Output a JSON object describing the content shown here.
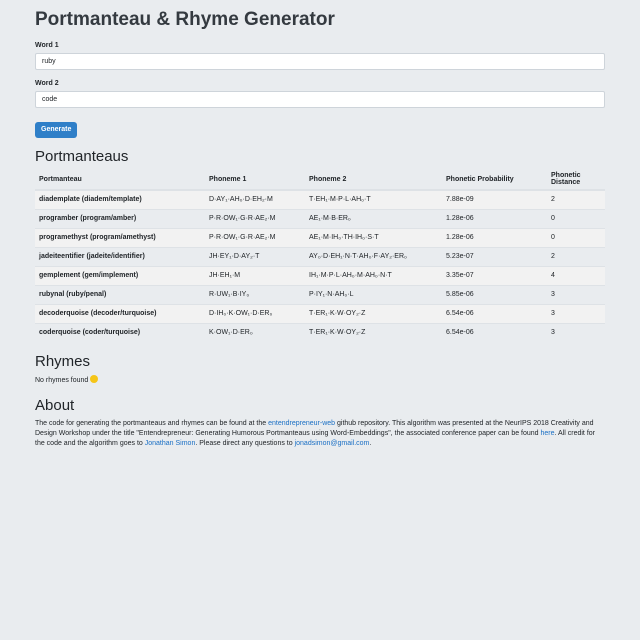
{
  "title": "Portmanteau & Rhyme Generator",
  "word1": {
    "label": "Word 1",
    "value": "ruby"
  },
  "word2": {
    "label": "Word 2",
    "value": "code"
  },
  "generate_label": "Generate",
  "portmanteaus": {
    "heading": "Portmanteaus",
    "columns": [
      "Portmanteau",
      "Phoneme 1",
      "Phoneme 2",
      "Phonetic Probability",
      "Phonetic Distance"
    ],
    "rows": [
      {
        "word": "diadem​plate (diadem/template)",
        "p1": "D·AY₁·AH₀·D·EH₂·M",
        "p2": "T·EH₁·M·P·L·AH₀·T",
        "prob": "7.88e-09",
        "dist": "2"
      },
      {
        "word": "programber (program/amber)",
        "p1": "P·R·OW₁·G·R·AE₂·M",
        "p2": "AE₁·M·B·ER₀",
        "prob": "1.28e-06",
        "dist": "0"
      },
      {
        "word": "programethyst (program/amethyst)",
        "p1": "P·R·OW₁·G·R·AE₂·M",
        "p2": "AE₁·M·IH₀·TH·IH₀·S·T",
        "prob": "1.28e-06",
        "dist": "0"
      },
      {
        "word": "jadeiteentifier (jadeite/identifier)",
        "p1": "JH·EY₁·D·AY₂·T",
        "p2": "AY₀·D·EH₁·N·T·AH₀·F·AY₂·ER₀",
        "prob": "5.23e-07",
        "dist": "2"
      },
      {
        "word": "gemplement (gem/implement)",
        "p1": "JH·EH₁·M",
        "p2": "IH₁·M·P·L·AH₀·M·AH₀·N·T",
        "prob": "3.35e-07",
        "dist": "4"
      },
      {
        "word": "rubynal (ruby/penal)",
        "p1": "R·UW₁·B·IY₀",
        "p2": "P·IY₁·N·AH₀·L",
        "prob": "5.85e-06",
        "dist": "3"
      },
      {
        "word": "decoderquoise (decoder/turquoise)",
        "p1": "D·IH₀·K·OW₁·D·ER₀",
        "p2": "T·ER₁·K·W·OY₂·Z",
        "prob": "6.54e-06",
        "dist": "3"
      },
      {
        "word": "coderquoise (coder/turquoise)",
        "p1": "K·OW₁·D·ER₀",
        "p2": "T·ER₁·K·W·OY₂·Z",
        "prob": "6.54e-06",
        "dist": "3"
      }
    ]
  },
  "rhymes": {
    "heading": "Rhymes",
    "empty_text": "No rhymes found",
    "emoji_icon": "smiley-face-icon"
  },
  "about": {
    "heading": "About",
    "t1": "The code for generating the portmanteaus and rhymes can be found at the ",
    "link1": "entendrepreneur-web",
    "t2": " github repository. This algorithm was presented at the NeurIPS 2018 Creativity and Design Workshop under the title \"Entendrepreneur: Generating Humorous Portmanteaus using Word-Embeddings\", the associated conference paper can be found ",
    "link2": "here",
    "t3": ". All credit for the code and the algorithm goes to ",
    "link3": "Jonathan Simon",
    "t4": ". Please direct any questions to ",
    "link4": "jonadsimon@gmail.com",
    "t5": "."
  },
  "colors": {
    "accent": "#2f7fc8",
    "link": "#1a6fc4",
    "background": "#e9ecef"
  }
}
